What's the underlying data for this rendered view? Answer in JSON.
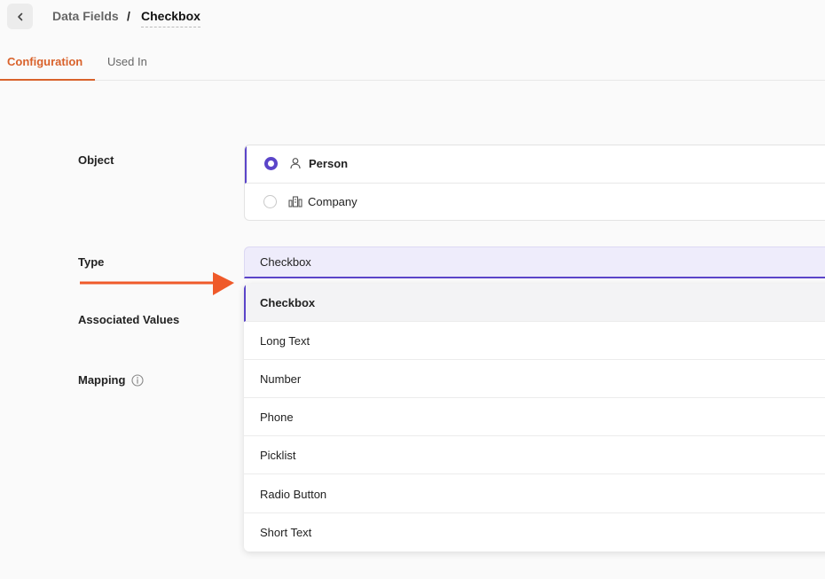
{
  "breadcrumb": {
    "parent": "Data Fields",
    "separator": "/",
    "current": "Checkbox"
  },
  "tabs": [
    {
      "label": "Configuration",
      "active": true
    },
    {
      "label": "Used In",
      "active": false
    }
  ],
  "form": {
    "object_label": "Object",
    "type_label": "Type",
    "associated_values_label": "Associated Values",
    "mapping_label": "Mapping",
    "object_options": [
      {
        "label": "Person",
        "icon": "person-icon",
        "selected": true
      },
      {
        "label": "Company",
        "icon": "building-icon",
        "selected": false
      }
    ],
    "type_value": "Checkbox",
    "type_options": [
      {
        "label": "Checkbox",
        "active": true
      },
      {
        "label": "Long Text"
      },
      {
        "label": "Number"
      },
      {
        "label": "Phone"
      },
      {
        "label": "Picklist"
      },
      {
        "label": "Radio Button"
      },
      {
        "label": "Short Text"
      }
    ]
  },
  "colors": {
    "accent": "#d9622b",
    "primary": "#5b45c9",
    "arrow": "#ef5a2a"
  }
}
